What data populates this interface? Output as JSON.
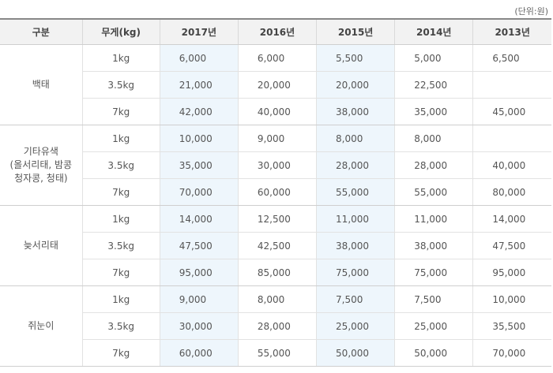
{
  "unit_label": "(단위:원)",
  "headers": [
    "구분",
    "무게(kg)",
    "2017년",
    "2016년",
    "2015년",
    "2014년",
    "2013년"
  ],
  "groups": [
    {
      "category": "백태",
      "rows": [
        {
          "weight": "1kg",
          "values": [
            "6,000",
            "6,000",
            "5,500",
            "5,000",
            "6,500"
          ]
        },
        {
          "weight": "3.5kg",
          "values": [
            "21,000",
            "20,000",
            "20,000",
            "22,500",
            ""
          ]
        },
        {
          "weight": "7kg",
          "values": [
            "42,000",
            "40,000",
            "38,000",
            "35,000",
            "45,000"
          ]
        }
      ]
    },
    {
      "category": "기타유색\n(올서리태, 밤콩\n청자콩, 청태)",
      "rows": [
        {
          "weight": "1kg",
          "values": [
            "10,000",
            "9,000",
            "8,000",
            "8,000",
            ""
          ]
        },
        {
          "weight": "3.5kg",
          "values": [
            "35,000",
            "30,000",
            "28,000",
            "28,000",
            "40,000"
          ]
        },
        {
          "weight": "7kg",
          "values": [
            "70,000",
            "60,000",
            "55,000",
            "55,000",
            "80,000"
          ]
        }
      ]
    },
    {
      "category": "늦서리태",
      "rows": [
        {
          "weight": "1kg",
          "values": [
            "14,000",
            "12,500",
            "11,000",
            "11,000",
            "14,000"
          ]
        },
        {
          "weight": "3.5kg",
          "values": [
            "47,500",
            "42,500",
            "38,000",
            "38,000",
            "47,500"
          ]
        },
        {
          "weight": "7kg",
          "values": [
            "95,000",
            "85,000",
            "75,000",
            "75,000",
            "95,000"
          ]
        }
      ]
    },
    {
      "category": "쥐눈이",
      "rows": [
        {
          "weight": "1kg",
          "values": [
            "9,000",
            "8,000",
            "7,500",
            "7,500",
            "10,000"
          ]
        },
        {
          "weight": "3.5kg",
          "values": [
            "30,000",
            "28,000",
            "25,000",
            "25,000",
            "35,500"
          ]
        },
        {
          "weight": "7kg",
          "values": [
            "60,000",
            "55,000",
            "50,000",
            "50,000",
            "70,000"
          ]
        }
      ]
    }
  ],
  "colors": {
    "highlight_column": "#eef6fc",
    "header_background": "#f2f2f2"
  }
}
